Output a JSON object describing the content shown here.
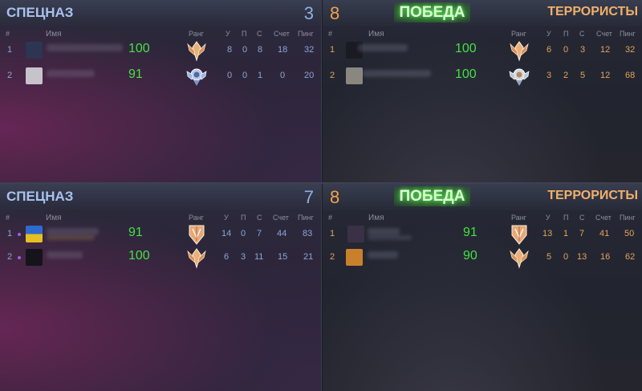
{
  "columns": {
    "num": "#",
    "name": "Имя",
    "rank": "Ранг",
    "kills": "У",
    "assists": "П",
    "deaths": "С",
    "score": "Счет",
    "ping": "Пинг"
  },
  "matches": [
    {
      "ct": {
        "team": "СПЕЦНАЗ",
        "score": "3",
        "players": [
          {
            "num": "1",
            "level": "100",
            "rank": "gold-wings-icon",
            "kills": "8",
            "assists": "0",
            "deaths": "8",
            "score": "18",
            "ping": "32"
          },
          {
            "num": "2",
            "level": "91",
            "rank": "silver-wings-icon",
            "kills": "0",
            "assists": "0",
            "deaths": "1",
            "score": "0",
            "ping": "20"
          }
        ]
      },
      "t": {
        "team": "ТЕРРОРИСТЫ",
        "score": "8",
        "result": "ПОБЕДА",
        "players": [
          {
            "num": "1",
            "level": "100",
            "rank": "gold-wings-icon",
            "kills": "6",
            "assists": "0",
            "deaths": "3",
            "score": "12",
            "ping": "32"
          },
          {
            "num": "2",
            "level": "100",
            "rank": "silver-wings-icon",
            "kills": "3",
            "assists": "2",
            "deaths": "5",
            "score": "12",
            "ping": "68"
          }
        ]
      }
    },
    {
      "ct": {
        "team": "СПЕЦНАЗ",
        "score": "7",
        "players": [
          {
            "num": "1",
            "level": "91",
            "rank": "gold-shield-icon",
            "kills": "14",
            "assists": "0",
            "deaths": "7",
            "score": "44",
            "ping": "83"
          },
          {
            "num": "2",
            "level": "100",
            "rank": "gold-wings-icon",
            "kills": "6",
            "assists": "3",
            "deaths": "11",
            "score": "15",
            "ping": "21"
          }
        ]
      },
      "t": {
        "team": "ТЕРРОРИСТЫ",
        "score": "8",
        "result": "ПОБЕДА",
        "players": [
          {
            "num": "1",
            "level": "91",
            "rank": "gold-shield-icon",
            "kills": "13",
            "assists": "1",
            "deaths": "7",
            "score": "41",
            "ping": "50"
          },
          {
            "num": "2",
            "level": "90",
            "rank": "gold-wings-icon",
            "kills": "5",
            "assists": "0",
            "deaths": "13",
            "score": "16",
            "ping": "62"
          }
        ]
      }
    }
  ],
  "colors": {
    "ct_accent": "#a9c2ee",
    "t_accent": "#f0b06a",
    "victory": "#3f8a3a",
    "level": "#44e044"
  }
}
